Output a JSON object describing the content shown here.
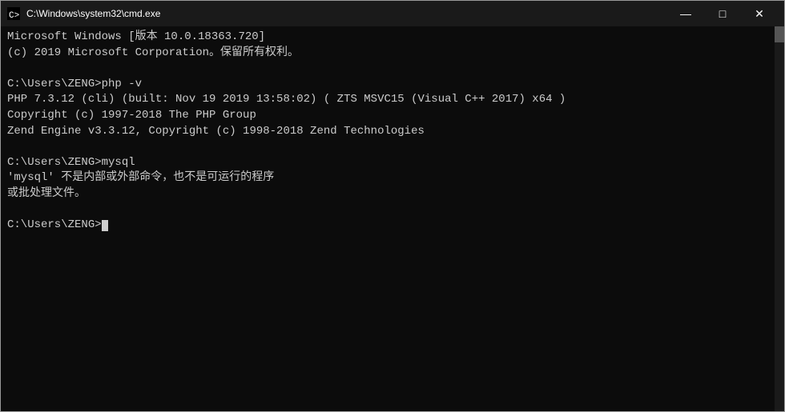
{
  "titleBar": {
    "icon": "cmd-icon",
    "title": "C:\\Windows\\system32\\cmd.exe",
    "minimizeLabel": "—",
    "maximizeLabel": "□",
    "closeLabel": "✕"
  },
  "terminal": {
    "lines": [
      "Microsoft Windows [版本 10.0.18363.720]",
      "(c) 2019 Microsoft Corporation。保留所有权利。",
      "",
      "C:\\Users\\ZENG>php -v",
      "PHP 7.3.12 (cli) (built: Nov 19 2019 13:58:02) ( ZTS MSVC15 (Visual C++ 2017) x64 )",
      "Copyright (c) 1997-2018 The PHP Group",
      "Zend Engine v3.3.12, Copyright (c) 1998-2018 Zend Technologies",
      "",
      "C:\\Users\\ZENG>mysql",
      "'mysql' 不是内部或外部命令，也不是可运行的程序",
      "或批处理文件。",
      "",
      "C:\\Users\\ZENG>"
    ],
    "promptCursor": true
  }
}
